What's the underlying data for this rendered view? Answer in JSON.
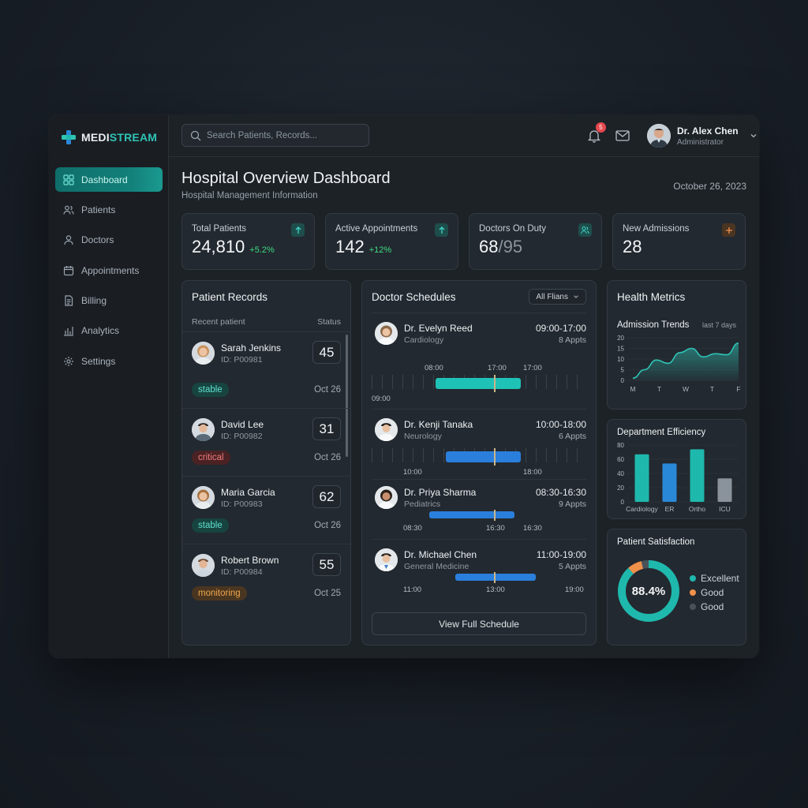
{
  "brand": {
    "name_prefix": "MEDI",
    "name_suffix": "STREAM"
  },
  "sidebar": {
    "items": [
      {
        "label": "Dashboard",
        "icon": "grid-icon"
      },
      {
        "label": "Patients",
        "icon": "users-icon"
      },
      {
        "label": "Doctors",
        "icon": "user-icon"
      },
      {
        "label": "Appointments",
        "icon": "calendar-icon"
      },
      {
        "label": "Billing",
        "icon": "document-icon"
      },
      {
        "label": "Analytics",
        "icon": "bar-chart-icon"
      },
      {
        "label": "Settings",
        "icon": "gear-icon"
      }
    ]
  },
  "topbar": {
    "search_placeholder": "Search Patients, Records...",
    "notification_count": "5",
    "user_name": "Dr. Alex Chen",
    "user_role": "Administrator"
  },
  "header": {
    "title": "Hospital Overview Dashboard",
    "subtitle": "Hospital Management Information",
    "date": "October 26, 2023"
  },
  "stats": [
    {
      "label": "Total Patients",
      "value": "24,810",
      "delta": "+5.2%"
    },
    {
      "label": "Active Appointments",
      "value": "142",
      "delta": "+12%"
    },
    {
      "label": "Doctors On Duty",
      "value": "68",
      "value_total": "/95"
    },
    {
      "label": "New Admissions",
      "value": "28"
    }
  ],
  "patient_records": {
    "title": "Patient Records",
    "col_left": "Recent patient",
    "col_right": "Status",
    "rows": [
      {
        "name": "Sarah Jenkins",
        "id": "ID: P00981",
        "score": "45",
        "status": "stable",
        "date": "Oct 26"
      },
      {
        "name": "David Lee",
        "id": "ID: P00982",
        "score": "31",
        "status": "critical",
        "date": "Oct 26"
      },
      {
        "name": "Maria Garcia",
        "id": "ID: P00983",
        "score": "62",
        "status": "stable",
        "date": "Oct 26"
      },
      {
        "name": "Robert Brown",
        "id": "ID: P00984",
        "score": "55",
        "status": "monitoring",
        "date": "Oct 25"
      }
    ]
  },
  "schedules": {
    "title": "Doctor Schedules",
    "filter": "All Flians",
    "button": "View Full Schedule",
    "doctors": [
      {
        "name": "Dr. Evelyn Reed",
        "specialty": "Cardiology",
        "hours": "09:00-17:00",
        "appts": "8 Appts",
        "labels": [
          "08:00",
          "17:00",
          "17:00",
          "09:00"
        ]
      },
      {
        "name": "Dr. Kenji Tanaka",
        "specialty": "Neurology",
        "hours": "10:00-18:00",
        "appts": "6 Appts",
        "labels": [
          "10:00",
          "18:00"
        ]
      },
      {
        "name": "Dr. Priya Sharma",
        "specialty": "Pediatrics",
        "hours": "08:30-16:30",
        "appts": "9 Appts",
        "labels": [
          "08:30",
          "16:30",
          "16:30"
        ]
      },
      {
        "name": "Dr. Michael Chen",
        "specialty": "General Medicine",
        "hours": "11:00-19:00",
        "appts": "5 Appts",
        "labels": [
          "11:00",
          "13:00",
          "19:00"
        ]
      }
    ]
  },
  "health_metrics": {
    "title": "Health Metrics",
    "trend_title": "Admission Trends",
    "trend_note": "last 7 days",
    "dept_title": "Department Efficiency",
    "sat_title": "Patient Satisfaction"
  },
  "chart_data": [
    {
      "type": "area",
      "title": "Admission Trends",
      "x": [
        "M",
        "T",
        "W",
        "T",
        "F"
      ],
      "y_ticks": [
        0,
        5,
        10,
        15,
        20
      ],
      "ylim": [
        0,
        20
      ],
      "values": [
        1,
        5,
        9.5,
        8,
        13,
        15,
        11,
        12.5,
        12,
        17.5
      ],
      "color": "#2ec4b6"
    },
    {
      "type": "bar",
      "title": "Department Efficiency",
      "categories": [
        "Cardiology",
        "ER",
        "Ortho",
        "ICU"
      ],
      "values": [
        67,
        54,
        74,
        33
      ],
      "y_ticks": [
        0,
        20,
        40,
        60,
        80
      ],
      "ylim": [
        0,
        80
      ],
      "colors": [
        "#1fb8ad",
        "#2a88d8",
        "#1fb8ad",
        "#8a939b"
      ]
    },
    {
      "type": "pie",
      "title": "Patient Satisfaction",
      "center_label": "88.4%",
      "slices": [
        {
          "name": "Excellent",
          "value": 88.4,
          "color": "#1fb8ad"
        },
        {
          "name": "Good",
          "value": 7.6,
          "color": "#f0914a"
        },
        {
          "name": "Good",
          "value": 4.0,
          "color": "#4a5259"
        }
      ]
    }
  ],
  "colors": {
    "accent": "#2ec4b6",
    "blue": "#2a88d8",
    "orange": "#f0914a",
    "danger": "#e5484d"
  }
}
